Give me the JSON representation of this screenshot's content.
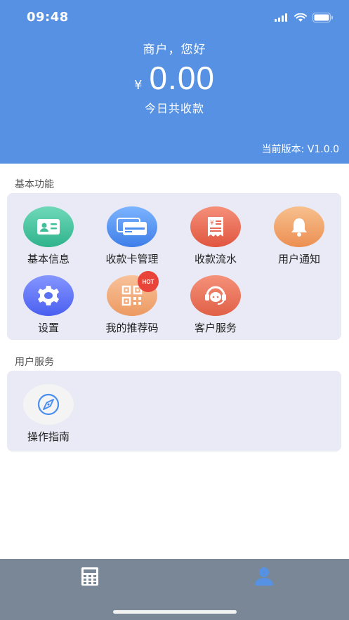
{
  "status_bar": {
    "time": "09:48"
  },
  "header": {
    "greeting": "商户，您好",
    "currency_symbol": "¥",
    "amount": "0.00",
    "amount_label": "今日共收款",
    "version": "当前版本: V1.0.0",
    "background_color": "#5691e3"
  },
  "basic_functions": {
    "title": "基本功能",
    "items": [
      {
        "label": "基本信息",
        "icon": "id-card-icon",
        "color": "#3fbf9a"
      },
      {
        "label": "收款卡管理",
        "icon": "bank-card-icon",
        "color": "#4a8ff0"
      },
      {
        "label": "收款流水",
        "icon": "receipt-icon",
        "color": "#e86a55"
      },
      {
        "label": "用户通知",
        "icon": "bell-icon",
        "color": "#f0a060"
      },
      {
        "label": "设置",
        "icon": "gear-icon",
        "color": "#5b72f0"
      },
      {
        "label": "我的推荐码",
        "icon": "qr-code-icon",
        "color": "#f0a570",
        "badge": "HOT"
      },
      {
        "label": "客户服务",
        "icon": "customer-service-icon",
        "color": "#e8735e"
      }
    ]
  },
  "user_services": {
    "title": "用户服务",
    "items": [
      {
        "label": "操作指南",
        "icon": "compass-icon",
        "color": "#f4f4f4"
      }
    ]
  },
  "tab_bar": {
    "tabs": [
      {
        "icon": "calculator-icon",
        "active": false
      },
      {
        "icon": "user-icon",
        "active": true
      }
    ],
    "active_color": "#5691e3"
  }
}
